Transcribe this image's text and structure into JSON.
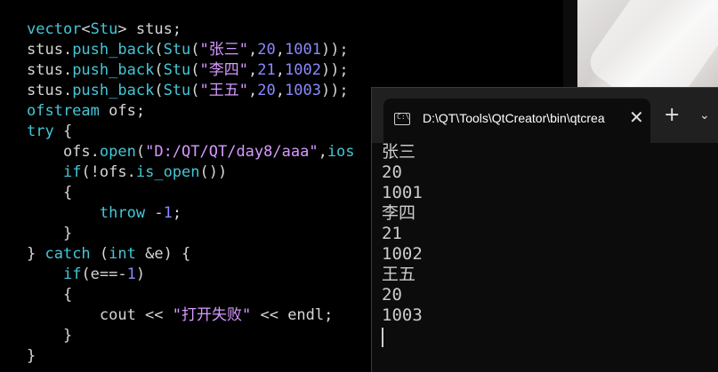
{
  "editor": {
    "code": [
      [
        {
          "c": "kw",
          "t": "vector"
        },
        {
          "c": "pl",
          "t": "<"
        },
        {
          "c": "kw",
          "t": "Stu"
        },
        {
          "c": "pl",
          "t": "> stus;"
        }
      ],
      [
        {
          "c": "pl",
          "t": "stus."
        },
        {
          "c": "kw",
          "t": "push_back"
        },
        {
          "c": "pl",
          "t": "("
        },
        {
          "c": "kw",
          "t": "Stu"
        },
        {
          "c": "pl",
          "t": "("
        },
        {
          "c": "str",
          "t": "\"张三\""
        },
        {
          "c": "pl",
          "t": ","
        },
        {
          "c": "num",
          "t": "20"
        },
        {
          "c": "pl",
          "t": ","
        },
        {
          "c": "num",
          "t": "1001"
        },
        {
          "c": "pl",
          "t": "));"
        }
      ],
      [
        {
          "c": "pl",
          "t": "stus."
        },
        {
          "c": "kw",
          "t": "push_back"
        },
        {
          "c": "pl",
          "t": "("
        },
        {
          "c": "kw",
          "t": "Stu"
        },
        {
          "c": "pl",
          "t": "("
        },
        {
          "c": "str",
          "t": "\"李四\""
        },
        {
          "c": "pl",
          "t": ","
        },
        {
          "c": "num",
          "t": "21"
        },
        {
          "c": "pl",
          "t": ","
        },
        {
          "c": "num",
          "t": "1002"
        },
        {
          "c": "pl",
          "t": "));"
        }
      ],
      [
        {
          "c": "pl",
          "t": "stus."
        },
        {
          "c": "kw",
          "t": "push_back"
        },
        {
          "c": "pl",
          "t": "("
        },
        {
          "c": "kw",
          "t": "Stu"
        },
        {
          "c": "pl",
          "t": "("
        },
        {
          "c": "str",
          "t": "\"王五\""
        },
        {
          "c": "pl",
          "t": ","
        },
        {
          "c": "num",
          "t": "20"
        },
        {
          "c": "pl",
          "t": ","
        },
        {
          "c": "num",
          "t": "1003"
        },
        {
          "c": "pl",
          "t": "));"
        }
      ],
      [
        {
          "c": "kw",
          "t": "ofstream"
        },
        {
          "c": "pl",
          "t": " ofs;"
        }
      ],
      [
        {
          "c": "kw",
          "t": "try"
        },
        {
          "c": "pl",
          "t": " {"
        }
      ],
      [
        {
          "c": "pl",
          "t": "    ofs."
        },
        {
          "c": "kw",
          "t": "open"
        },
        {
          "c": "pl",
          "t": "("
        },
        {
          "c": "str",
          "t": "\"D:/QT/QT/day8/aaa\""
        },
        {
          "c": "pl",
          "t": ","
        },
        {
          "c": "kw",
          "t": "ios"
        }
      ],
      [
        {
          "c": "pl",
          "t": "    "
        },
        {
          "c": "kw",
          "t": "if"
        },
        {
          "c": "pl",
          "t": "(!ofs."
        },
        {
          "c": "kw",
          "t": "is_open"
        },
        {
          "c": "pl",
          "t": "())"
        }
      ],
      [
        {
          "c": "pl",
          "t": "    {"
        }
      ],
      [
        {
          "c": "pl",
          "t": "        "
        },
        {
          "c": "kw",
          "t": "throw"
        },
        {
          "c": "pl",
          "t": " -"
        },
        {
          "c": "num",
          "t": "1"
        },
        {
          "c": "pl",
          "t": ";"
        }
      ],
      [
        {
          "c": "pl",
          "t": "    }"
        }
      ],
      [
        {
          "c": "pl",
          "t": "} "
        },
        {
          "c": "kw",
          "t": "catch"
        },
        {
          "c": "pl",
          "t": " ("
        },
        {
          "c": "kw",
          "t": "int"
        },
        {
          "c": "pl",
          "t": " &e) {"
        }
      ],
      [
        {
          "c": "pl",
          "t": "    "
        },
        {
          "c": "kw",
          "t": "if"
        },
        {
          "c": "pl",
          "t": "(e==-"
        },
        {
          "c": "num",
          "t": "1"
        },
        {
          "c": "pl",
          "t": ")"
        }
      ],
      [
        {
          "c": "pl",
          "t": "    {"
        }
      ],
      [
        {
          "c": "pl",
          "t": "        cout << "
        },
        {
          "c": "str",
          "t": "\"打开失败\""
        },
        {
          "c": "pl",
          "t": " << endl;"
        }
      ],
      [
        {
          "c": "pl",
          "t": "    }"
        }
      ],
      [
        {
          "c": "pl",
          "t": "}"
        }
      ]
    ]
  },
  "terminal": {
    "tab_icon_text": "C:\\",
    "tab_title": "D:\\QT\\Tools\\QtCreator\\bin\\qtcreator_process_stub.exe",
    "close_glyph": "✕",
    "new_tab_glyph": "+",
    "dropdown_glyph": "⌄",
    "output_lines": [
      "张三",
      "20",
      "1001",
      "李四",
      "21",
      "1002",
      "王五",
      "20",
      "1003"
    ]
  },
  "colors": {
    "keyword": "#45c6d6",
    "string": "#d69aff",
    "number": "#8a8aff",
    "plain": "#d6d6d6",
    "terminal_bg": "#0c0c0c",
    "tabbar_bg": "#202020"
  }
}
